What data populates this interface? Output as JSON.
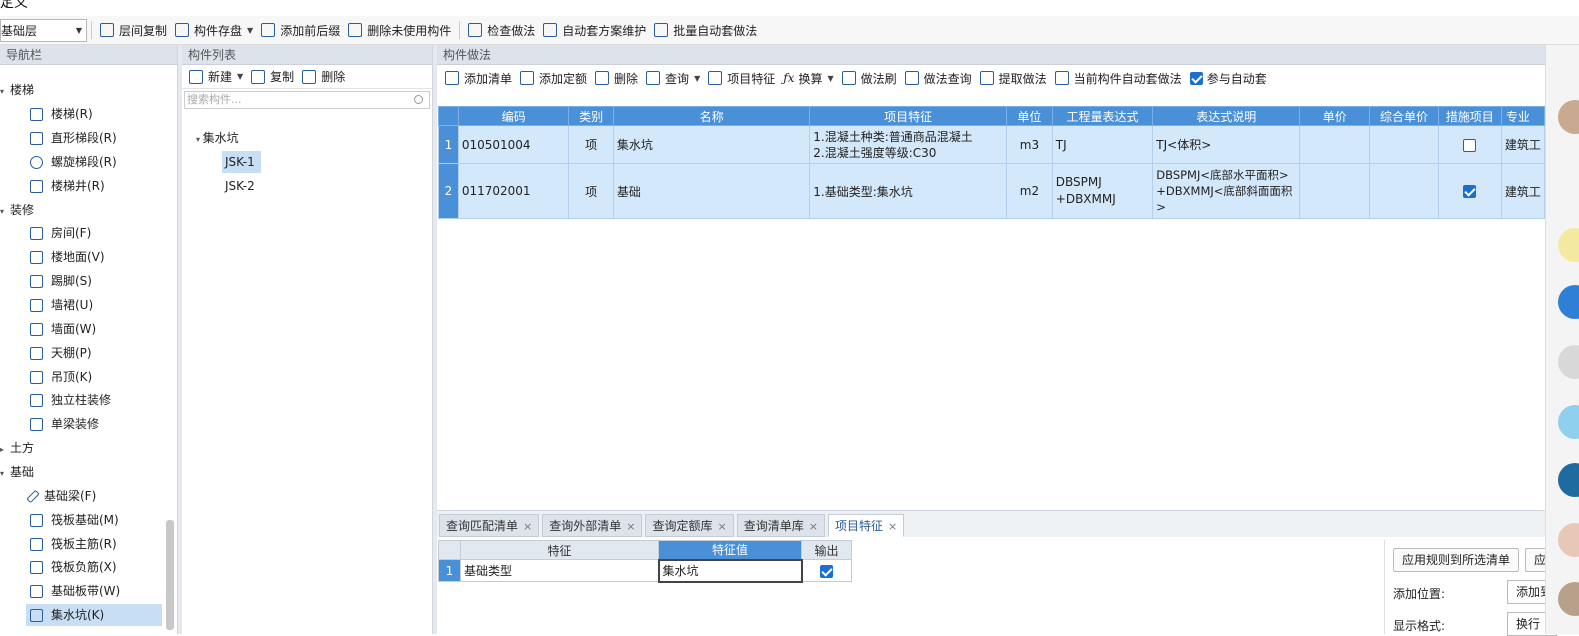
{
  "window": {
    "title": "定义"
  },
  "toolbar": {
    "floor_select": "基础层",
    "buttons": [
      "层间复制",
      "构件存盘",
      "添加前后缀",
      "删除未使用构件",
      "检查做法",
      "自动套方案维护",
      "批量自动套做法"
    ]
  },
  "nav": {
    "header": "导航栏",
    "groups": [
      {
        "label": "楼梯",
        "items": [
          "楼梯(R)",
          "直形梯段(R)",
          "螺旋梯段(R)",
          "楼梯井(R)"
        ]
      },
      {
        "label": "装修",
        "items": [
          "房间(F)",
          "楼地面(V)",
          "踢脚(S)",
          "墙裙(U)",
          "墙面(W)",
          "天棚(P)",
          "吊顶(K)",
          "独立柱装修",
          "单梁装修"
        ]
      },
      {
        "label": "土方",
        "items": []
      },
      {
        "label": "基础",
        "items": [
          "基础梁(F)",
          "筏板基础(M)",
          "筏板主筋(R)",
          "筏板负筋(X)",
          "基础板带(W)",
          "集水坑(K)"
        ]
      }
    ]
  },
  "component_list": {
    "header": "构件列表",
    "tools": {
      "new": "新建",
      "copy": "复制",
      "delete": "删除"
    },
    "search_placeholder": "搜索构件...",
    "tree_root": "集水坑",
    "items": [
      "JSK-1",
      "JSK-2"
    ]
  },
  "method": {
    "header": "构件做法",
    "tools": [
      "添加清单",
      "添加定额",
      "删除",
      "查询",
      "项目特征",
      "换算",
      "做法刷",
      "做法查询",
      "提取做法",
      "当前构件自动套做法"
    ],
    "auto_checkbox_label": "参与自动套",
    "columns": [
      "编码",
      "类别",
      "名称",
      "项目特征",
      "单位",
      "工程量表达式",
      "表达式说明",
      "单价",
      "综合单价",
      "措施项目",
      "专业"
    ],
    "rows": [
      {
        "no": "1",
        "code": "010501004",
        "type": "项",
        "name": "集水坑",
        "feature_1": "1.混凝土种类:普通商品混凝土",
        "feature_2": "2.混凝土强度等级:C30",
        "unit": "m3",
        "expr_1": "TJ",
        "expr_2": "",
        "desc_1": "TJ<体积>",
        "desc_2": "",
        "desc_3": "",
        "measure_checked": false,
        "specialty": "建筑工"
      },
      {
        "no": "2",
        "code": "011702001",
        "type": "项",
        "name": "基础",
        "feature_1": "1.基础类型:集水坑",
        "feature_2": "",
        "unit": "m2",
        "expr_1": "DBSPMJ",
        "expr_2": "+DBXMMJ",
        "desc_1": "DBSPMJ<底部水平面积>",
        "desc_2": "+DBXMMJ<底部斜面面积",
        "desc_3": ">",
        "measure_checked": true,
        "specialty": "建筑工"
      }
    ]
  },
  "bottom": {
    "tabs": [
      "查询匹配清单",
      "查询外部清单",
      "查询定额库",
      "查询清单库",
      "项目特征"
    ],
    "active_tab": "项目特征",
    "feature_columns": [
      "特征",
      "特征值",
      "输出"
    ],
    "feature_rows": [
      {
        "no": "1",
        "feature": "基础类型",
        "value": "集水坑",
        "output": true
      }
    ],
    "right_panel": {
      "apply_button": "应用规则到所选清单",
      "apply_button_2": "应",
      "add_position_label": "添加位置:",
      "add_position_value": "添加到",
      "display_format_label": "显示格式:",
      "display_format_value": "换行"
    }
  },
  "colors": {
    "accent": "#4a90d9",
    "selection": "#d4e8fb",
    "icon": "#2a5d9c"
  }
}
